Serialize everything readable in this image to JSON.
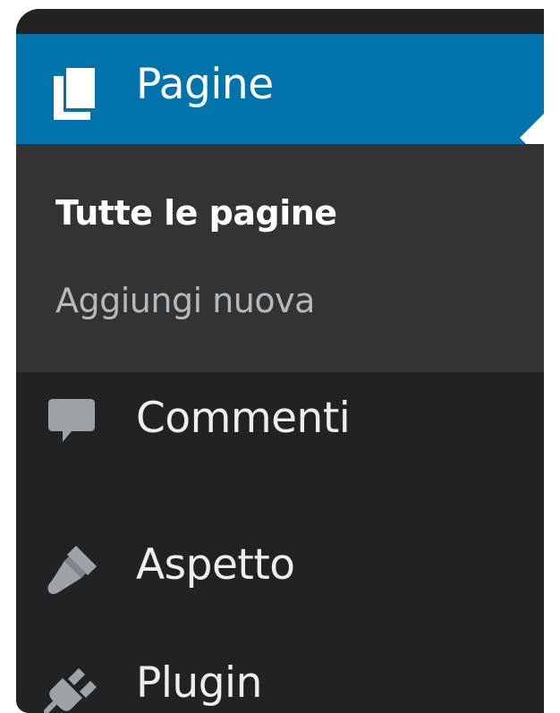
{
  "sidebar": {
    "active": {
      "label": "Pagine",
      "icon": "pages-icon"
    },
    "submenu": [
      {
        "label": "Tutte le pagine",
        "state": "current"
      },
      {
        "label": "Aggiungi nuova",
        "state": "normal"
      }
    ],
    "items": [
      {
        "label": "Commenti",
        "icon": "comment-icon"
      },
      {
        "label": "Aspetto",
        "icon": "paintbrush-icon"
      },
      {
        "label": "Plugin",
        "icon": "plug-icon"
      }
    ]
  },
  "colors": {
    "sidebar_bg": "#222222",
    "submenu_bg": "#333333",
    "active_bg": "#0073aa",
    "active_text": "#ffffff",
    "menu_text": "#eeeeee",
    "submenu_text": "#b4b9be",
    "icon_color": "#9ea3a8"
  }
}
